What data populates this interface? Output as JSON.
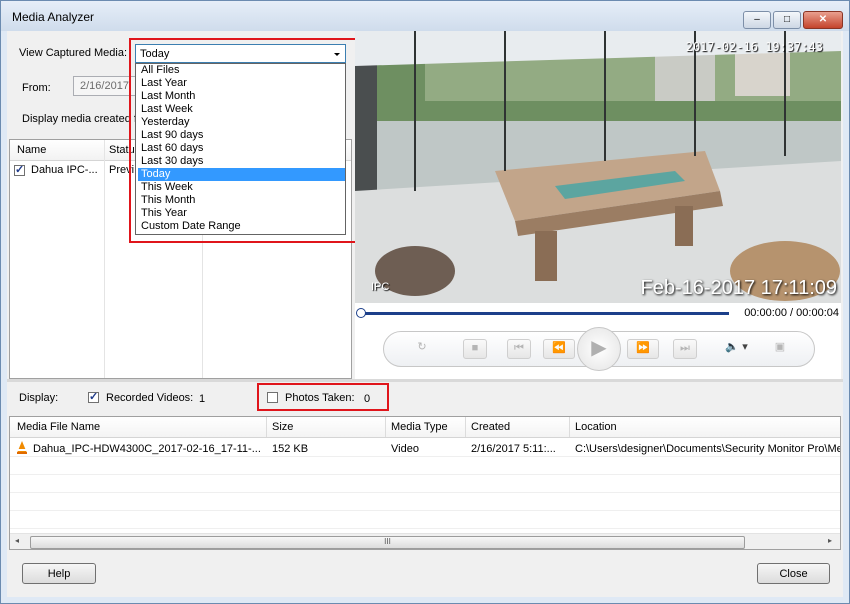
{
  "window": {
    "title": "Media Analyzer",
    "min_glyph": "‒",
    "max_glyph": "□",
    "close_glyph": "✕"
  },
  "filter": {
    "view_label": "View Captured Media:",
    "selected": "Today",
    "from_label": "From:",
    "from_value": "2/16/2017",
    "display_created_label": "Display media created fr",
    "options": [
      "All Files",
      "Last Year",
      "Last Month",
      "Last Week",
      "Yesterday",
      "Last 90 days",
      "Last 60 days",
      "Last 30 days",
      "Today",
      "This Week",
      "This Month",
      "This Year",
      "Custom Date Range"
    ],
    "selected_index": 8
  },
  "camera_list": {
    "columns": [
      "Name",
      "Status"
    ],
    "rows": [
      {
        "name": "Dahua IPC-...",
        "status": "Previ",
        "checked": true
      }
    ]
  },
  "video": {
    "osd_top": "2017-02-16 19:37:43",
    "osd_bottom": "Feb-16-2017 17:11:09",
    "osd_label": "IPC",
    "time": "00:00:00 / 00:00:04",
    "progress": 0
  },
  "controls": {
    "refresh_glyph": "↻",
    "stop_glyph": "■",
    "prev_glyph": "⏮",
    "rewind_glyph": "⏪",
    "play_glyph": "▶",
    "forward_glyph": "⏩",
    "next_glyph": "⏭",
    "volume_glyph": "🔈",
    "volume_arrow": "▾",
    "snapshot_glyph": "▣"
  },
  "display": {
    "label": "Display:",
    "recorded_label": "Recorded Videos:",
    "recorded_count": "1",
    "recorded_checked": true,
    "photos_label": "Photos Taken:",
    "photos_count": "0",
    "photos_checked": false
  },
  "media_table": {
    "columns": [
      "Media File Name",
      "Size",
      "Media Type",
      "Created",
      "Location"
    ],
    "rows": [
      {
        "name": "Dahua_IPC-HDW4300C_2017-02-16_17-11-...",
        "size": "152 KB",
        "type": "Video",
        "created": "2/16/2017 5:11:...",
        "location": "C:\\Users\\designer\\Documents\\Security Monitor Pro\\Med"
      }
    ],
    "scroll_left": "◂",
    "scroll_right": "▸",
    "scroll_grip": "III"
  },
  "buttons": {
    "help": "Help",
    "close": "Close"
  },
  "colors": {
    "highlight": "#3399ff",
    "annotation": "#e0151b"
  }
}
